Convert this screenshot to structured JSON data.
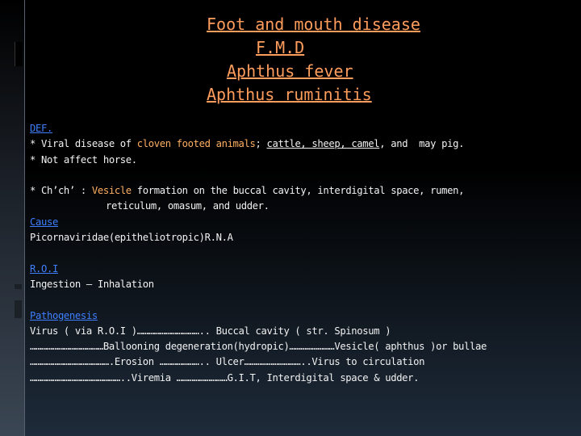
{
  "title": {
    "line1": "Foot and mouth disease",
    "line2": "F.M.D",
    "line3": "Aphthus fever",
    "line4": "Aphthus ruminitis"
  },
  "def": {
    "heading": "DEF.",
    "l1_a": "* Viral disease of ",
    "l1_b": "cloven footed animals",
    "l1_c": "; ",
    "l1_d": "cattle, sheep, camel",
    "l1_e": ", and  may pig.",
    "l2": "* Not affect horse."
  },
  "ch": {
    "l1_a": "* Ch’ch’ : ",
    "l1_b": "Vesicle",
    "l1_c": " formation on the buccal cavity, interdigital space, rumen,",
    "l2": "reticulum, omasum, and udder."
  },
  "cause": {
    "heading": "Cause",
    "text": "Picornaviridae(epitheliotropic)R.N.A"
  },
  "roi": {
    "heading": "R.O.I",
    "text": "Ingestion – Inhalation"
  },
  "pathogenesis": {
    "heading": "Pathogenesis",
    "l1": "Virus ( via R.O.I )…………………………….. Buccal cavity ( str. Spinosum )",
    "l2": "…………………………………Ballooning degeneration(hydropic)……………………Vesicle( aphthus )or bullae",
    "l3": "…………………………………….Erosion ………………….. Ulcer…………………………..Virus to circulation",
    "l4": "…………………………………………..Viremia ………………………G.I.T, Interdigital space & udder."
  }
}
